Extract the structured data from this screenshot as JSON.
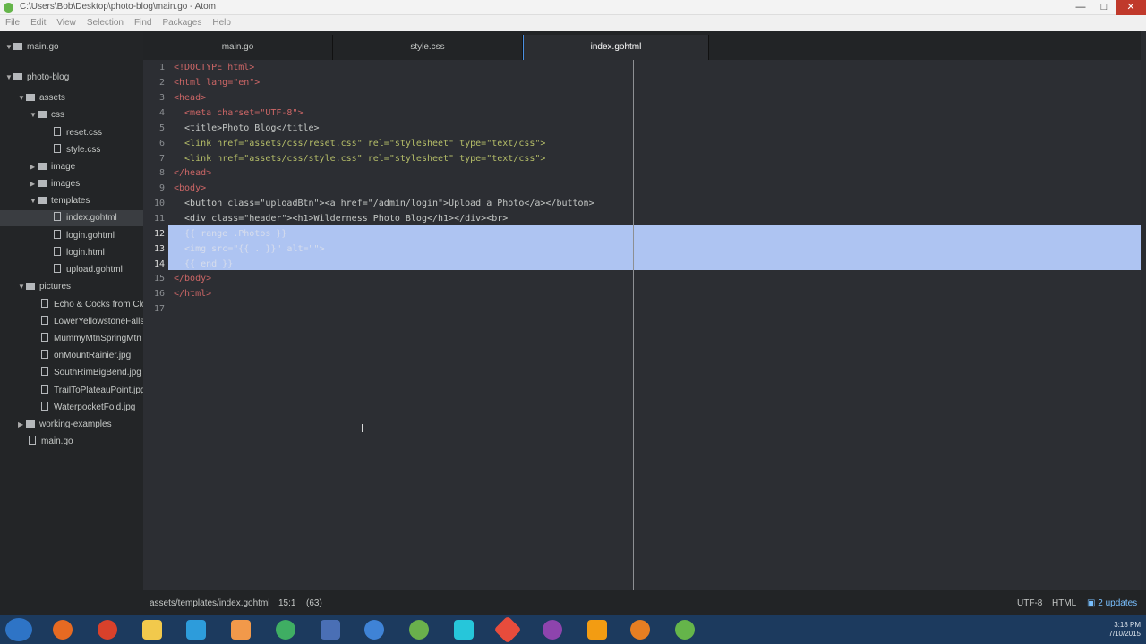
{
  "window": {
    "title": "C:\\Users\\Bob\\Desktop\\photo-blog\\main.go - Atom"
  },
  "menu": [
    "File",
    "Edit",
    "View",
    "Selection",
    "Find",
    "Packages",
    "Help"
  ],
  "tree": {
    "open_file": "main.go",
    "items": [
      {
        "label": "photo-blog",
        "type": "folder",
        "open": true
      },
      {
        "label": "assets",
        "type": "folder",
        "open": true
      },
      {
        "label": "css",
        "type": "folder",
        "open": true
      },
      {
        "label": "reset.css",
        "type": "file"
      },
      {
        "label": "style.css",
        "type": "file"
      },
      {
        "label": "image",
        "type": "folder",
        "open": false
      },
      {
        "label": "images",
        "type": "folder",
        "open": false
      },
      {
        "label": "templates",
        "type": "folder",
        "open": true
      },
      {
        "label": "index.gohtml",
        "type": "file",
        "selected": true
      },
      {
        "label": "login.gohtml",
        "type": "file"
      },
      {
        "label": "login.html",
        "type": "file"
      },
      {
        "label": "upload.gohtml",
        "type": "file"
      },
      {
        "label": "pictures",
        "type": "folder",
        "open": true
      },
      {
        "label": "Echo & Cocks from Clou",
        "type": "file"
      },
      {
        "label": "LowerYellowstoneFalls.",
        "type": "file"
      },
      {
        "label": "MummyMtnSpringMtn",
        "type": "file"
      },
      {
        "label": "onMountRainier.jpg",
        "type": "file"
      },
      {
        "label": "SouthRimBigBend.jpg",
        "type": "file"
      },
      {
        "label": "TrailToPlateauPoint.jpg",
        "type": "file"
      },
      {
        "label": "WaterpocketFold.jpg",
        "type": "file"
      },
      {
        "label": "working-examples",
        "type": "folder",
        "open": false
      },
      {
        "label": "main.go",
        "type": "file"
      }
    ]
  },
  "tabs": [
    {
      "label": "main.go",
      "active": false
    },
    {
      "label": "style.css",
      "active": false
    },
    {
      "label": "index.gohtml",
      "active": true
    }
  ],
  "editor": {
    "line_numbers": [
      "1",
      "2",
      "3",
      "4",
      "5",
      "6",
      "7",
      "8",
      "9",
      "10",
      "11",
      "12",
      "13",
      "14",
      "15",
      "16",
      "17"
    ],
    "lines": [
      "<!DOCTYPE html>",
      "<html lang=\"en\">",
      "<head>",
      "  <meta charset=\"UTF-8\">",
      "  <title>Photo Blog</title>",
      "  <link href=\"assets/css/reset.css\" rel=\"stylesheet\" type=\"text/css\">",
      "  <link href=\"assets/css/style.css\" rel=\"stylesheet\" type=\"text/css\">",
      "</head>",
      "<body>",
      "  <button class=\"uploadBtn\"><a href=\"/admin/login\">Upload a Photo</a></button>",
      "  <div class=\"header\"><h1>Wilderness Photo Blog</h1></div><br>",
      "  {{ range .Photos }}",
      "  <img src=\"{{ . }}\" alt=\"\">",
      "  {{ end }}",
      "</body>",
      "</html>",
      ""
    ]
  },
  "status": {
    "path": "assets/templates/index.gohtml",
    "cursor": "15:1",
    "selection": "(63)",
    "encoding": "UTF-8",
    "grammar": "HTML",
    "updates": "2 updates"
  },
  "taskbar": {
    "time": "3:18 PM",
    "date": "7/10/2015"
  },
  "colors": {
    "selection": "#aec4f2",
    "editor_bg": "#2c2e33",
    "tag": "#cc6666",
    "string": "#b5bd68"
  }
}
